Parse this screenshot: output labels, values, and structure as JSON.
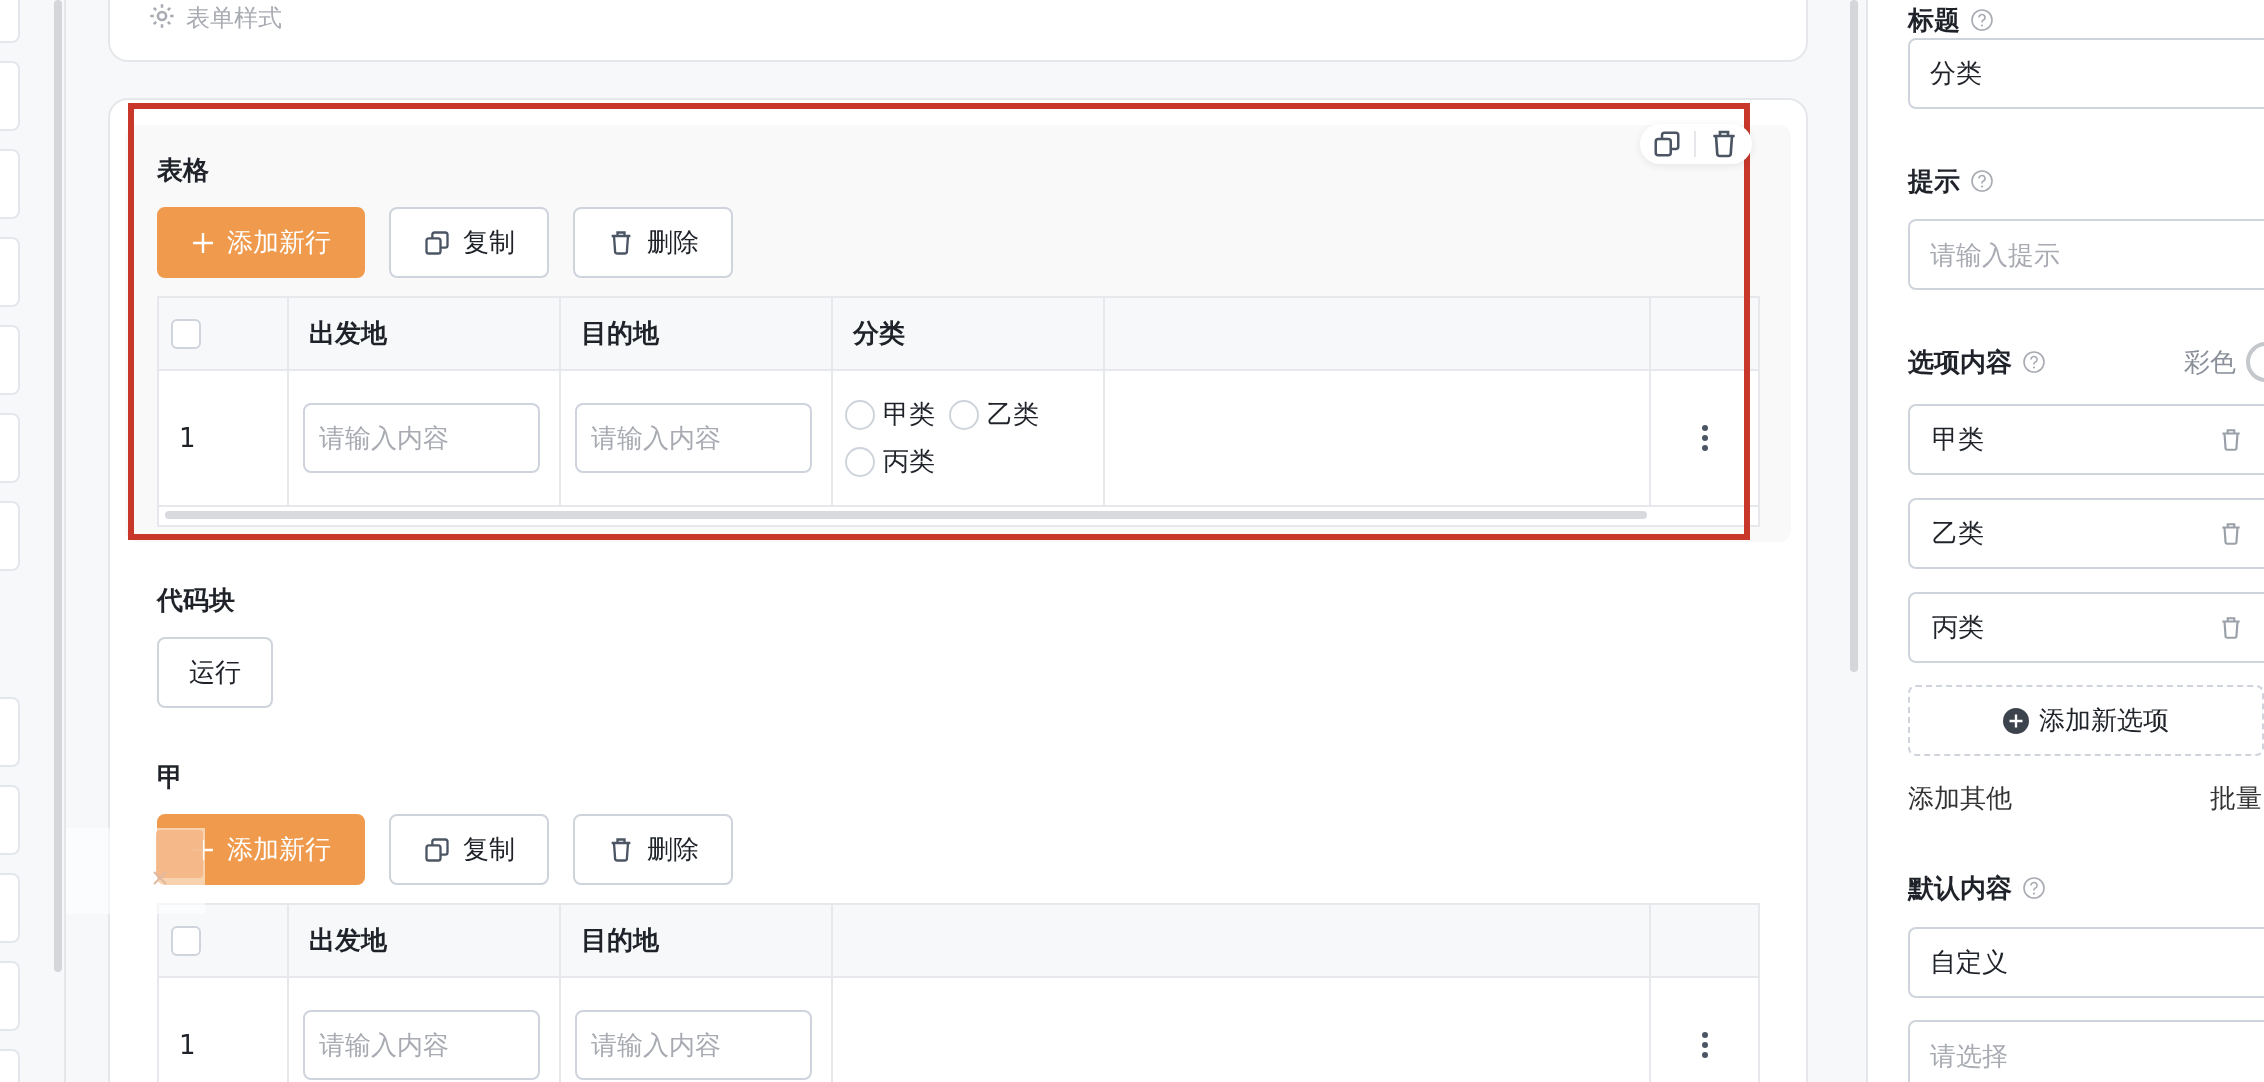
{
  "form_style": {
    "label": "表单样式"
  },
  "blocks": [
    {
      "kind": "table",
      "label": "表格",
      "highlighted": true,
      "select_all_checked": false,
      "actions": {
        "add": "添加新行",
        "copy": "复制",
        "delete": "删除"
      },
      "columns": [
        "出发地",
        "目的地",
        "分类"
      ],
      "rows": [
        {
          "index": "1",
          "cells": [
            {
              "kind": "input",
              "placeholder": "请输入内容"
            },
            {
              "kind": "input",
              "placeholder": "请输入内容"
            },
            {
              "kind": "radio",
              "options": [
                {
                  "label": "甲类",
                  "selected": false
                },
                {
                  "label": "乙类",
                  "selected": false
                },
                {
                  "label": "丙类",
                  "selected": false
                }
              ]
            }
          ]
        }
      ]
    },
    {
      "kind": "code",
      "label": "代码块",
      "button": "运行"
    },
    {
      "kind": "table",
      "label": "甲",
      "highlighted": false,
      "select_all_checked": false,
      "actions": {
        "add": "添加新行",
        "copy": "复制",
        "delete": "删除"
      },
      "columns": [
        "出发地",
        "目的地"
      ],
      "rows": [
        {
          "index": "1",
          "cells": [
            {
              "kind": "input",
              "placeholder": "请输入内容"
            },
            {
              "kind": "input",
              "placeholder": "请输入内容"
            }
          ]
        }
      ]
    }
  ],
  "properties": {
    "title_label": "标题",
    "title_value": "分类",
    "hint_label": "提示",
    "hint_placeholder": "请输入提示",
    "options_label": "选项内容",
    "color_label": "彩色",
    "options": [
      "甲类",
      "乙类",
      "丙类"
    ],
    "add_option": "添加新选项",
    "add_other": "添加其他",
    "batch": "批量",
    "default_label": "默认内容",
    "default_value": "自定义",
    "default_placeholder": "请选择"
  }
}
